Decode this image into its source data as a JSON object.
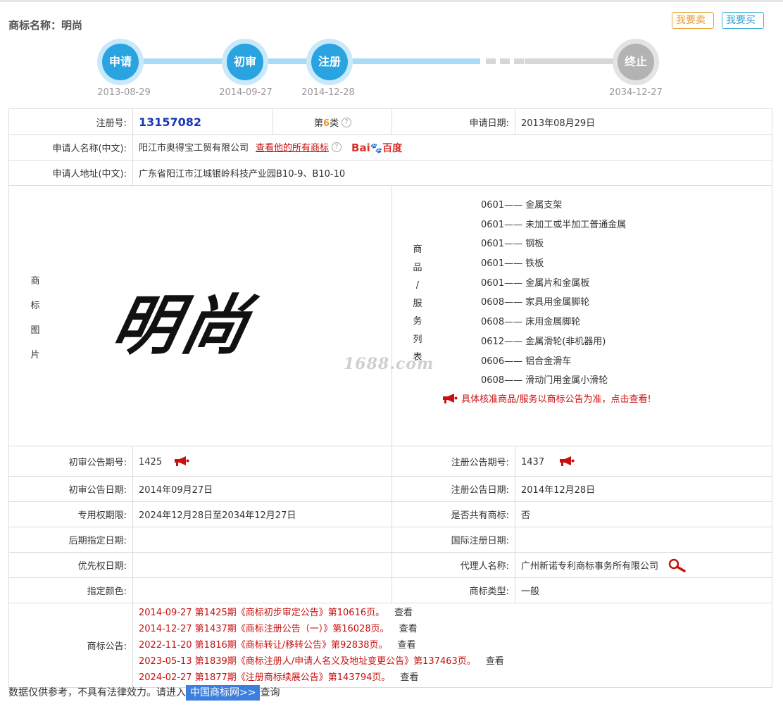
{
  "header": {
    "title": "商标名称：明尚",
    "sell_label": "我要卖",
    "buy_label": "我要买"
  },
  "timeline": {
    "steps": [
      {
        "label": "申请",
        "date": "2013-08-29"
      },
      {
        "label": "初审",
        "date": "2014-09-27"
      },
      {
        "label": "注册",
        "date": "2014-12-28"
      },
      {
        "label": "终止",
        "date": "2034-12-27"
      }
    ]
  },
  "info": {
    "reg_no_label": "注册号:",
    "reg_no": "13157082",
    "class_prefix": "第",
    "class_num": "6",
    "class_suffix": "类",
    "apply_date_label": "申请日期:",
    "apply_date": "2013年08月29日",
    "applicant_label": "申请人名称(中文):",
    "applicant": "阳江市奥得宝工贸有限公司",
    "view_all_link": "查看他的所有商标",
    "baidu_bai": "Bai",
    "baidu_du": "百度",
    "address_label": "申请人地址(中文):",
    "address": "广东省阳江市江城银岭科技产业园B10-9、B10-10",
    "image_label": [
      "商",
      "标",
      "图",
      "片"
    ],
    "logo_text": "明尚",
    "watermark": "1688.com",
    "goods_label": [
      "商",
      "品",
      "/",
      "服",
      "务",
      "列",
      "表"
    ],
    "goods": [
      "0601—— 金属支架",
      "0601—— 未加工或半加工普通金属",
      "0601—— 钢板",
      "0601—— 铁板",
      "0601—— 金属片和金属板",
      "0608—— 家具用金属脚轮",
      "0608—— 床用金属脚轮",
      "0612—— 金属滑轮(非机器用)",
      "0606—— 铝合金滑车",
      "0608—— 滑动门用金属小滑轮"
    ],
    "goods_note": "具体核准商品/服务以商标公告为准，点击查看!",
    "prelim_no_label": "初审公告期号:",
    "prelim_no": "1425",
    "reg_notice_no_label": "注册公告期号:",
    "reg_notice_no": "1437",
    "prelim_date_label": "初审公告日期:",
    "prelim_date": "2014年09月27日",
    "reg_notice_date_label": "注册公告日期:",
    "reg_notice_date": "2014年12月28日",
    "exclusive_label": "专用权期限:",
    "exclusive": "2024年12月28日至2034年12月27日",
    "shared_label": "是否共有商标:",
    "shared": "否",
    "later_label": "后期指定日期:",
    "later": "",
    "intl_label": "国际注册日期:",
    "intl": "",
    "priority_label": "优先权日期:",
    "priority": "",
    "agent_label": "代理人名称:",
    "agent": "广州新诺专利商标事务所有限公司",
    "color_label": "指定颜色:",
    "color": "",
    "type_label": "商标类型:",
    "type": "一般",
    "notice_label": "商标公告:",
    "view_label": "查看",
    "notices": [
      "2014-09-27 第1425期《商标初步审定公告》第10616页。",
      "2014-12-27 第1437期《商标注册公告（一）》第16028页。",
      "2022-11-20 第1816期《商标转让/移转公告》第92838页。",
      "2023-05-13 第1839期《商标注册人/申请人名义及地址变更公告》第137463页。",
      "2024-02-27 第1877期《注册商标续展公告》第143794页。"
    ]
  },
  "footer": {
    "prefix": "数据仅供参考，不具有法律效力。请进入",
    "link": "中国商标网>>",
    "suffix": "查询"
  },
  "colors": {
    "primary_blue": "#29a4e1",
    "red_text": "#c81010",
    "orange": "#e8962a"
  }
}
